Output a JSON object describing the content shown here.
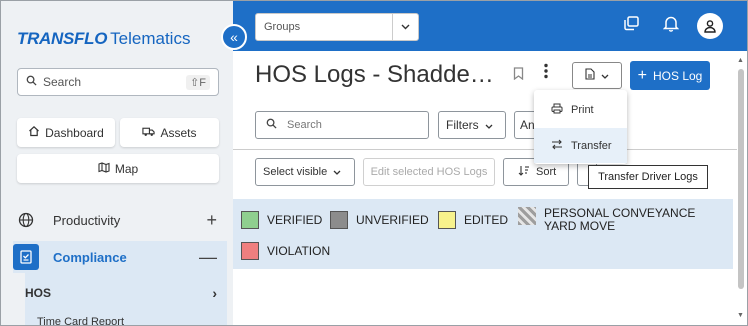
{
  "sidebar": {
    "logo_brand": "TRANSFLO",
    "logo_product": "Telematics",
    "collapse_icon": "«",
    "search_placeholder": "Search",
    "search_shortcut": "⇧F",
    "dashboard_label": "Dashboard",
    "assets_label": "Assets",
    "map_label": "Map",
    "items": [
      {
        "label": "Productivity",
        "toggle": "+"
      },
      {
        "label": "Compliance",
        "toggle": "—"
      }
    ],
    "subitems": [
      {
        "label": "HOS",
        "chevron": "›"
      },
      {
        "label": "Time Card Report"
      }
    ]
  },
  "topbar": {
    "groups_label": "Groups",
    "accent": "#1e6fc7"
  },
  "page": {
    "title": "HOS Logs - Shadde…",
    "hos_log_button": "HOS Log",
    "search_placeholder": "Search",
    "filters_label": "Filters",
    "an_label": "An",
    "select_visible_label": "Select visible",
    "edit_selected_label": "Edit selected HOS Logs",
    "sort_label": "Sort"
  },
  "legend": {
    "items": [
      {
        "label": "VERIFIED",
        "color": "#8fcf8f"
      },
      {
        "label": "UNVERIFIED",
        "color": "#8c8c8c"
      },
      {
        "label": "EDITED",
        "color": "#f7f28c"
      },
      {
        "label": "PERSONAL CONVEYANCE",
        "label2": "YARD MOVE",
        "pattern": "hatched"
      },
      {
        "label": "VIOLATION",
        "color": "#ef7f7f"
      }
    ]
  },
  "menu": {
    "print_label": "Print",
    "transfer_label": "Transfer",
    "tooltip": "Transfer Driver Logs"
  }
}
